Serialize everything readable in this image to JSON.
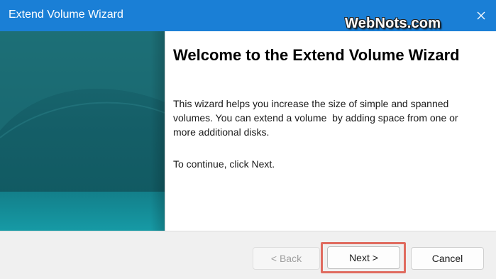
{
  "window": {
    "title": "Extend Volume Wizard",
    "watermark": "WebNots.com",
    "close_icon": "close-icon"
  },
  "banner": {
    "colors": {
      "top": "#196a74",
      "mid": "#0f5f67",
      "bottom": "#128a95",
      "arc": "#1e7882"
    }
  },
  "content": {
    "heading": "Welcome to the Extend Volume Wizard",
    "description": "This wizard helps you increase the size of simple and spanned volumes. You can extend a volume  by adding space from one or more additional disks.",
    "continue_text": "To continue, click Next."
  },
  "buttons": {
    "back": "< Back",
    "next": "Next >",
    "cancel": "Cancel"
  },
  "colors": {
    "titlebar": "#1a7fd6",
    "highlight": "#e06b5f"
  }
}
